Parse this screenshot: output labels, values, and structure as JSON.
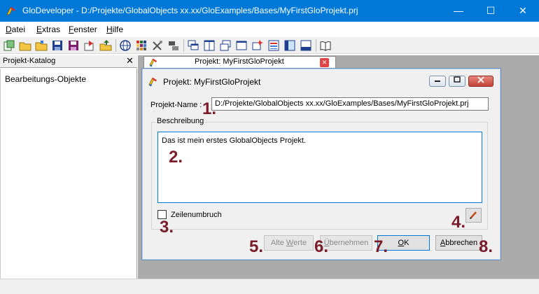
{
  "window": {
    "title": "GloDeveloper - D:/Projekte/GlobalObjects xx.xx/GloExamples/Bases/MyFirstGloProjekt.prj",
    "minimize": "—",
    "maximize": "☐",
    "close": "✕"
  },
  "menu": [
    {
      "key": "D",
      "rest": "atei"
    },
    {
      "key": "E",
      "rest": "xtras"
    },
    {
      "key": "F",
      "rest": "enster"
    },
    {
      "key": "H",
      "rest": "ilfe"
    }
  ],
  "left_panel": {
    "title": "Projekt-Katalog",
    "close": "✕",
    "item": "Bearbeitungs-Objekte"
  },
  "doc_tab": {
    "label": "Projekt: MyFirstGloProjekt",
    "close": "✕"
  },
  "dialog": {
    "title": "Projekt: MyFirstGloProjekt",
    "name_label": "Projekt-Name :",
    "name_value": "D:/Projekte/GlobalObjects xx.xx/GloExamples/Bases/MyFirstGloProjekt.prj",
    "group_label": "Beschreibung",
    "description": "Das ist mein erstes GlobalObjects Projekt.",
    "wrap_label": "Zeilenumbruch",
    "btn_defaults": {
      "pre": "Alte ",
      "key": "W",
      "post": "erte"
    },
    "btn_apply": {
      "pre": "",
      "key": "Ü",
      "post": "bernehmen"
    },
    "btn_ok": {
      "pre": "",
      "key": "O",
      "post": "K"
    },
    "btn_cancel": {
      "pre": "",
      "key": "A",
      "post": "bbrechen"
    }
  },
  "callouts": [
    "1.",
    "2.",
    "3.",
    "4.",
    "5.",
    "6.",
    "7.",
    "8."
  ],
  "colors": {
    "titlebar": "#0078d7",
    "callout": "#7b1c2a",
    "mdi_background": "#ababab"
  }
}
